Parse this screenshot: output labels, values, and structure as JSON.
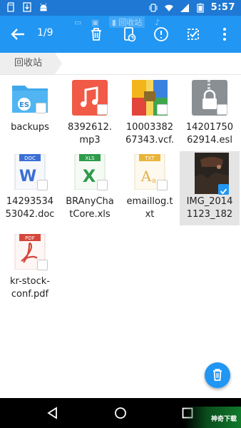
{
  "status_bar": {
    "time": "5:57",
    "left_icons": [
      "sd-card-icon",
      "download-icon",
      "android-icon"
    ],
    "right_icons": [
      "vibrate-icon",
      "wifi-icon",
      "signal-icon",
      "battery-icon"
    ]
  },
  "toolbar": {
    "count": "1/9",
    "subtitle": "回收站",
    "actions": [
      "back",
      "delete",
      "restore",
      "info",
      "select-all",
      "more"
    ]
  },
  "breadcrumb": {
    "label": "回收站"
  },
  "files": [
    {
      "name": "backups",
      "type": "folder",
      "selected": false
    },
    {
      "name": "8392612.mp3",
      "type": "mp3",
      "selected": false
    },
    {
      "name": "1000338267343.vcf.",
      "type": "archive",
      "selected": false
    },
    {
      "name": "1420175062914.esl",
      "type": "locked",
      "selected": false
    },
    {
      "name": "1429353453042.doc",
      "type": "doc",
      "badge": "DOC",
      "selected": false
    },
    {
      "name": "BRAnyChatCore.xls",
      "type": "xls",
      "badge": "XLS",
      "selected": false
    },
    {
      "name": "emaillog.txt",
      "type": "txt",
      "badge": "TXT",
      "selected": false
    },
    {
      "name": "IMG_20141123_182",
      "type": "image",
      "selected": true
    },
    {
      "name": "kr-stock-conf.pdf",
      "type": "pdf",
      "badge": "PDF",
      "selected": false
    }
  ],
  "file_lines": {
    "f0": [
      "backups"
    ],
    "f1": [
      "8392612.",
      "mp3"
    ],
    "f2": [
      "10003382",
      "67343.vcf."
    ],
    "f3": [
      "14201750",
      "62914.esl"
    ],
    "f4": [
      "14293534",
      "53042.doc"
    ],
    "f5": [
      "BRAnyCha",
      "tCore.xls"
    ],
    "f6": [
      "emaillog.t",
      "xt"
    ],
    "f7": [
      "IMG_2014",
      "1123_182"
    ],
    "f8": [
      "kr-stock-",
      "conf.pdf"
    ]
  },
  "watermark": "神奇下载",
  "colors": {
    "toolbar": "#2196f3",
    "status_bar": "#1e78d4",
    "fab": "#2196f3",
    "selected_bg": "#e4e4e4"
  }
}
